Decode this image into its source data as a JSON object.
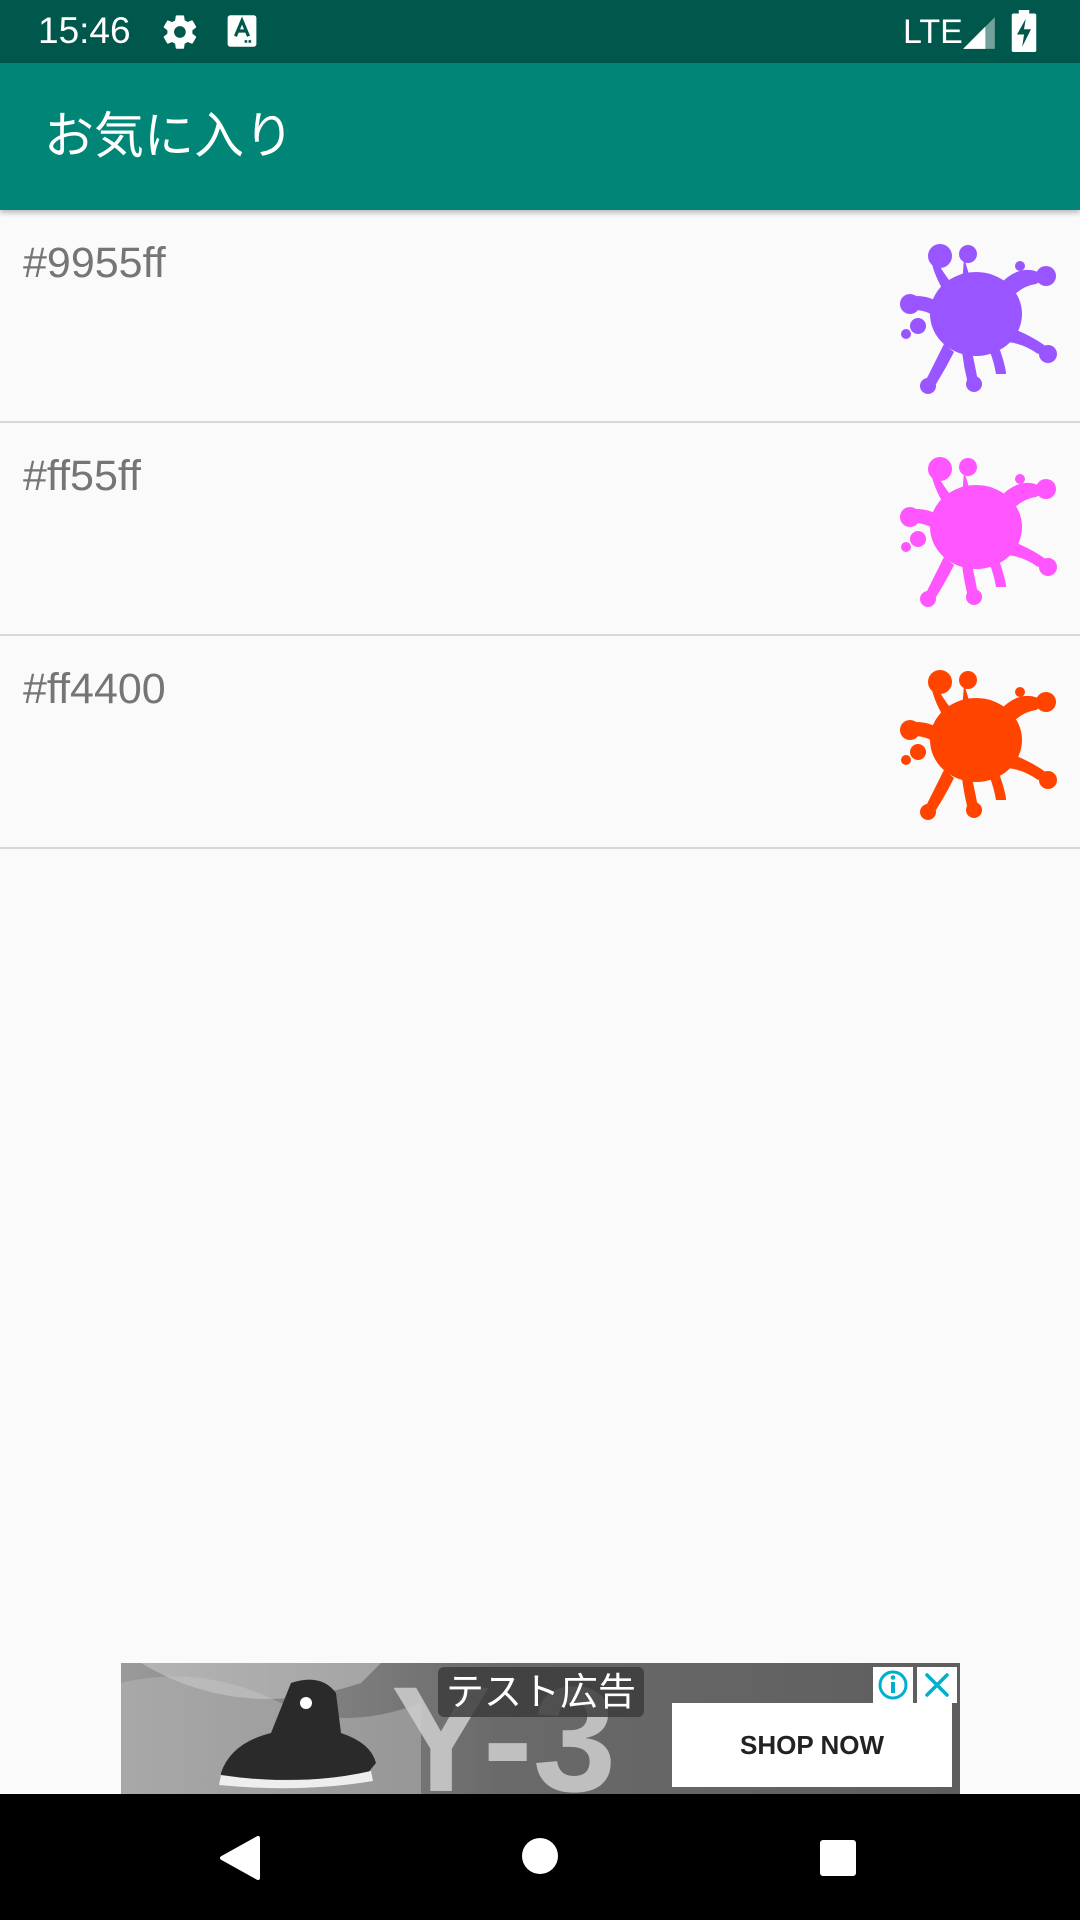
{
  "status_bar": {
    "time": "15:46",
    "network": "LTE",
    "icons": [
      "gear-icon",
      "keyboard-a-icon",
      "signal-icon",
      "battery-charging-icon"
    ]
  },
  "app_bar": {
    "title": "お気に入り",
    "color": "#008577"
  },
  "favorites": [
    {
      "label": "#9955ff",
      "color": "#9955ff"
    },
    {
      "label": "#ff55ff",
      "color": "#ff55ff"
    },
    {
      "label": "#ff4400",
      "color": "#ff4400"
    }
  ],
  "ad": {
    "label": "テスト広告",
    "cta": "SHOP NOW"
  },
  "nav_bar": {
    "icons": [
      "back-icon",
      "home-icon",
      "recents-icon"
    ]
  }
}
